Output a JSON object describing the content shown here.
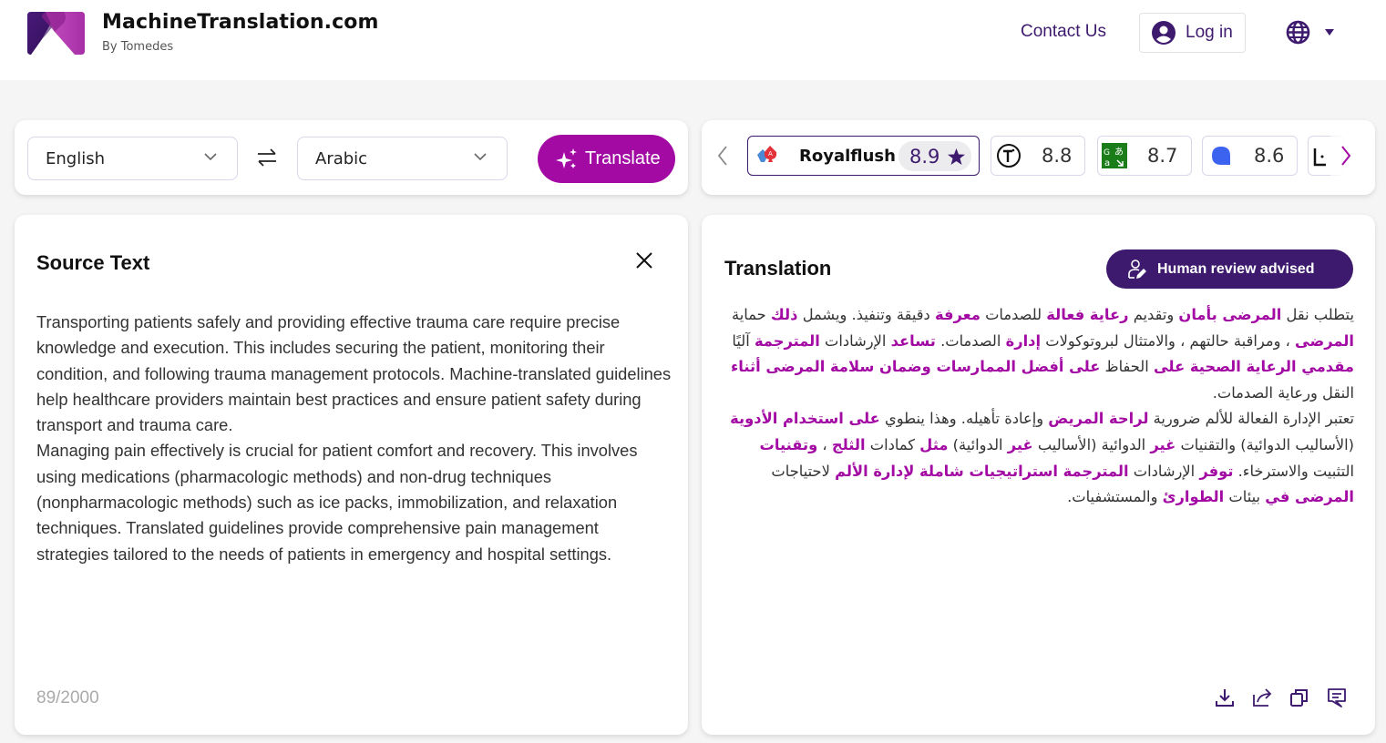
{
  "header": {
    "brand_title": "MachineTranslation.com",
    "brand_subtitle": "By Tomedes",
    "contact_label": "Contact Us",
    "login_label": "Log in",
    "icons": {
      "logo": "brand-logo",
      "user": "user-circle-icon",
      "globe": "globe-icon",
      "caret": "caret-down-icon"
    },
    "colors": {
      "primary": "#3d1a6e",
      "accent": "#a30aa3"
    }
  },
  "language_bar": {
    "source_language": "English",
    "target_language": "Arabic",
    "translate_label": "Translate",
    "icons": {
      "swap": "swap-arrows-icon",
      "chevron": "chevron-down-icon",
      "sparkle": "sparkle-icon"
    }
  },
  "engines": {
    "items": [
      {
        "name": "Royalflush",
        "score": "8.9",
        "active": true,
        "icon": "royalflush-cards-icon",
        "starred": true
      },
      {
        "name": "",
        "score": "8.8",
        "active": false,
        "icon": "t-circle-icon"
      },
      {
        "name": "",
        "score": "8.7",
        "active": false,
        "icon": "google-translate-icon"
      },
      {
        "name": "",
        "score": "8.6",
        "active": false,
        "icon": "blue-blob-icon"
      },
      {
        "name": "",
        "score": "",
        "active": false,
        "icon": "partial-engine-icon"
      }
    ],
    "icons": {
      "prev": "chevron-left-icon",
      "next": "chevron-right-icon",
      "star": "star-icon"
    }
  },
  "source": {
    "title": "Source Text",
    "paragraphs": [
      "Transporting patients safely and providing effective trauma care require precise knowledge and execution. This includes securing the patient, monitoring their condition, and following trauma management protocols. Machine-translated guidelines help healthcare providers maintain best practices and ensure patient safety during transport and trauma care.",
      "Managing pain effectively is crucial for patient comfort and recovery. This involves using medications (pharmacologic methods) and non-drug techniques (nonpharmacologic methods) such as ice packs, immobilization, and relaxation techniques. Translated guidelines provide comprehensive pain management strategies tailored to the needs of patients in emergency and hospital settings."
    ],
    "char_count": "89/2000",
    "icons": {
      "close": "close-icon"
    }
  },
  "translation": {
    "title": "Translation",
    "review_badge": "Human review advised",
    "paragraphs": [
      [
        {
          "t": "يتطلب نقل ",
          "h": false
        },
        {
          "t": "المرضى بأمان",
          "h": true
        },
        {
          "t": " وتقديم ",
          "h": false
        },
        {
          "t": "رعاية فعالة",
          "h": true
        },
        {
          "t": " للصدمات ",
          "h": false
        },
        {
          "t": "معرفة",
          "h": true
        },
        {
          "t": " دقيقة وتنفيذ. ويشمل ",
          "h": false
        },
        {
          "t": "ذلك",
          "h": true
        },
        {
          "t": " حماية ",
          "h": false
        },
        {
          "t": "المرضى",
          "h": true
        },
        {
          "t": " ، ومراقبة حالتهم ، والامتثال لبروتوكولات ",
          "h": false
        },
        {
          "t": "إدارة",
          "h": true
        },
        {
          "t": " الصدمات. ",
          "h": false
        },
        {
          "t": "تساعد",
          "h": true
        },
        {
          "t": " الإرشادات ",
          "h": false
        },
        {
          "t": "المترجمة",
          "h": true
        },
        {
          "t": " آليًا ",
          "h": false
        },
        {
          "t": "مقدمي الرعاية الصحية على",
          "h": true
        },
        {
          "t": " الحفاظ ",
          "h": false
        },
        {
          "t": "على أفضل الممارسات وضمان سلامة المرضى أثناء",
          "h": true
        },
        {
          "t": " النقل ورعاية الصدمات.",
          "h": false
        }
      ],
      [
        {
          "t": "تعتبر الإدارة الفعالة للألم ضرورية ",
          "h": false
        },
        {
          "t": "لراحة المريض",
          "h": true
        },
        {
          "t": " وإعادة تأهيله. وهذا ينطوي ",
          "h": false
        },
        {
          "t": "على استخدام الأدوية",
          "h": true
        },
        {
          "t": " (الأساليب الدوائية) والتقنيات ",
          "h": false
        },
        {
          "t": "غير",
          "h": true
        },
        {
          "t": " الدوائية (الأساليب ",
          "h": false
        },
        {
          "t": "غير",
          "h": true
        },
        {
          "t": " الدوائية) ",
          "h": false
        },
        {
          "t": "مثل",
          "h": true
        },
        {
          "t": " كمادات ",
          "h": false
        },
        {
          "t": "الثلج",
          "h": true
        },
        {
          "t": " ، ",
          "h": false
        },
        {
          "t": "وتقنيات",
          "h": true
        },
        {
          "t": " التثبيت والاسترخاء. ",
          "h": false
        },
        {
          "t": "توفر",
          "h": true
        },
        {
          "t": " الإرشادات ",
          "h": false
        },
        {
          "t": "المترجمة استراتيجيات شاملة لإدارة الألم",
          "h": true
        },
        {
          "t": " لاحتياجات ",
          "h": false
        },
        {
          "t": "المرضى في",
          "h": true
        },
        {
          "t": " بيئات ",
          "h": false
        },
        {
          "t": "الطوارئ",
          "h": true
        },
        {
          "t": " والمستشفيات.",
          "h": false
        }
      ]
    ],
    "actions": [
      {
        "name": "download",
        "icon": "download-icon"
      },
      {
        "name": "share",
        "icon": "share-icon"
      },
      {
        "name": "copy",
        "icon": "copy-icon"
      },
      {
        "name": "feedback",
        "icon": "comment-icon"
      }
    ],
    "icons": {
      "review": "human-review-icon"
    }
  }
}
